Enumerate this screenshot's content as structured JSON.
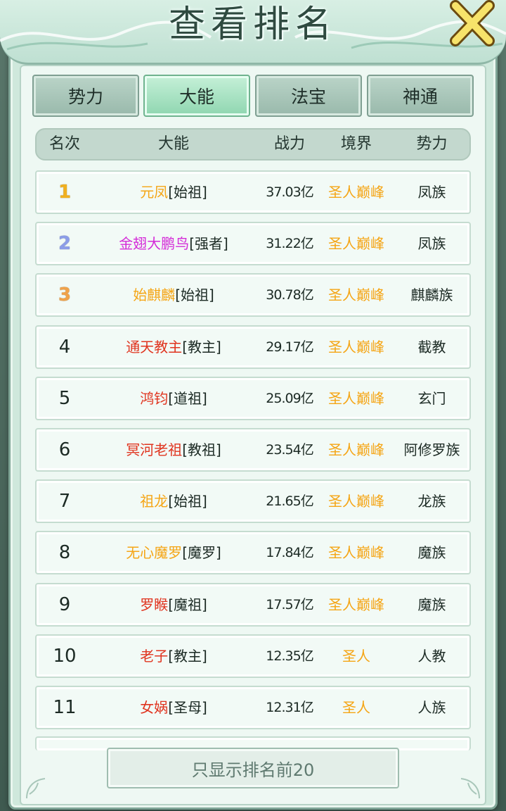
{
  "title": "查看排名",
  "tabs": [
    {
      "label": "势力",
      "active": false
    },
    {
      "label": "大能",
      "active": true
    },
    {
      "label": "法宝",
      "active": false
    },
    {
      "label": "神通",
      "active": false
    }
  ],
  "columns": {
    "rank": "名次",
    "name": "大能",
    "power": "战力",
    "realm": "境界",
    "faction": "势力"
  },
  "rows": [
    {
      "rank": "1",
      "name": "元凤",
      "title": "[始祖]",
      "name_color": "#f5a515",
      "power": "37.03亿",
      "realm": "圣人巅峰",
      "faction": "凤族"
    },
    {
      "rank": "2",
      "name": "金翅大鹏鸟",
      "title": "[强者]",
      "name_color": "#d42bd8",
      "power": "31.22亿",
      "realm": "圣人巅峰",
      "faction": "凤族"
    },
    {
      "rank": "3",
      "name": "始麒麟",
      "title": "[始祖]",
      "name_color": "#f5a515",
      "power": "30.78亿",
      "realm": "圣人巅峰",
      "faction": "麒麟族"
    },
    {
      "rank": "4",
      "name": "通天教主",
      "title": "[教主]",
      "name_color": "#e0341f",
      "power": "29.17亿",
      "realm": "圣人巅峰",
      "faction": "截教"
    },
    {
      "rank": "5",
      "name": "鸿钧",
      "title": "[道祖]",
      "name_color": "#e0341f",
      "power": "25.09亿",
      "realm": "圣人巅峰",
      "faction": "玄门"
    },
    {
      "rank": "6",
      "name": "冥河老祖",
      "title": "[教祖]",
      "name_color": "#e0341f",
      "power": "23.54亿",
      "realm": "圣人巅峰",
      "faction": "阿修罗族"
    },
    {
      "rank": "7",
      "name": "祖龙",
      "title": "[始祖]",
      "name_color": "#f5a515",
      "power": "21.65亿",
      "realm": "圣人巅峰",
      "faction": "龙族"
    },
    {
      "rank": "8",
      "name": "无心魔罗",
      "title": "[魔罗]",
      "name_color": "#f5a515",
      "power": "17.84亿",
      "realm": "圣人巅峰",
      "faction": "魔族"
    },
    {
      "rank": "9",
      "name": "罗睺",
      "title": "[魔祖]",
      "name_color": "#e0341f",
      "power": "17.57亿",
      "realm": "圣人巅峰",
      "faction": "魔族"
    },
    {
      "rank": "10",
      "name": "老子",
      "title": "[教主]",
      "name_color": "#e0341f",
      "power": "12.35亿",
      "realm": "圣人",
      "faction": "人教"
    },
    {
      "rank": "11",
      "name": "女娲",
      "title": "[圣母]",
      "name_color": "#e0341f",
      "power": "12.31亿",
      "realm": "圣人",
      "faction": "人族"
    }
  ],
  "realm_color": "#f5a515",
  "bottom_button": "只显示排名前20",
  "icons": {
    "close": "close-icon"
  }
}
